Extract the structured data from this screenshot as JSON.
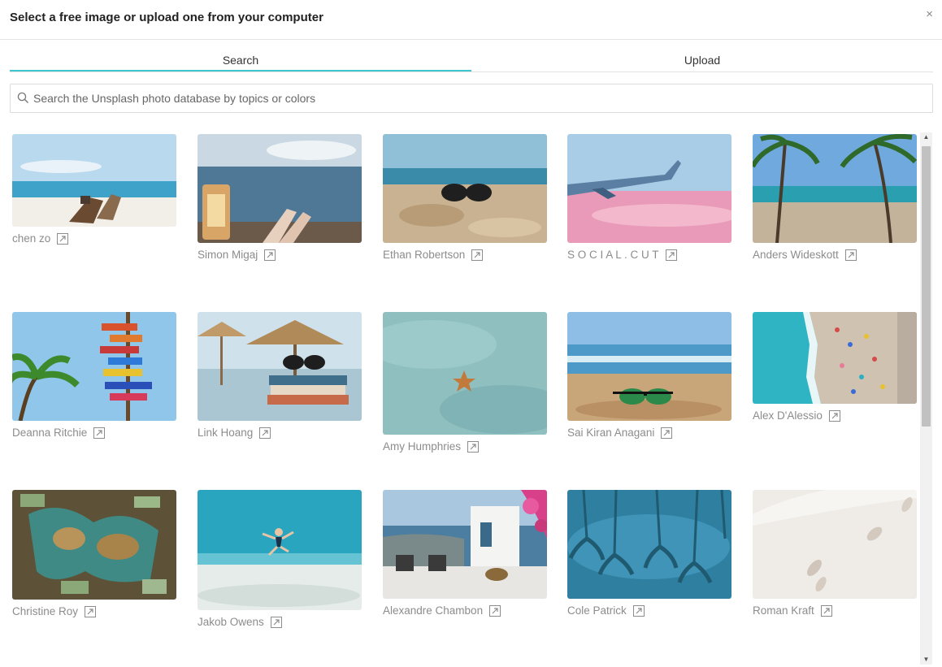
{
  "dialog": {
    "title": "Select a free image or upload one from your computer",
    "close_label": "×"
  },
  "tabs": [
    {
      "label": "Search",
      "active": true
    },
    {
      "label": "Upload",
      "active": false
    }
  ],
  "search": {
    "placeholder": "Search the Unsplash photo database by topics or colors",
    "value": ""
  },
  "photos": [
    {
      "author": "chen zo",
      "scene": "beach-chair"
    },
    {
      "author": "Simon Migaj",
      "scene": "lantern-sea"
    },
    {
      "author": "Ethan Robertson",
      "scene": "sunglasses-sand"
    },
    {
      "author": "S O C I A L . C U T",
      "scene": "airplane-wing"
    },
    {
      "author": "Anders Wideskott",
      "scene": "palm-beach"
    },
    {
      "author": "Deanna Ritchie",
      "scene": "signpost-palm"
    },
    {
      "author": "Link Hoang",
      "scene": "books-umbrella"
    },
    {
      "author": "Amy Humphries",
      "scene": "starfish"
    },
    {
      "author": "Sai Kiran Anagani",
      "scene": "sunglasses-beach"
    },
    {
      "author": "Alex D'Alessio",
      "scene": "aerial-beach"
    },
    {
      "author": "Christine Roy",
      "scene": "money-map"
    },
    {
      "author": "Jakob Owens",
      "scene": "jumping-beach"
    },
    {
      "author": "Alexandre Chambon",
      "scene": "santorini-terrace"
    },
    {
      "author": "Cole Patrick",
      "scene": "palm-reflection"
    },
    {
      "author": "Roman Kraft",
      "scene": "footprints-sand"
    }
  ],
  "icons": {
    "search": "search-icon",
    "external": "external-link-icon",
    "close": "close-icon"
  },
  "colors": {
    "accent": "#3cc7cf",
    "caption": "#8c8c8c"
  }
}
